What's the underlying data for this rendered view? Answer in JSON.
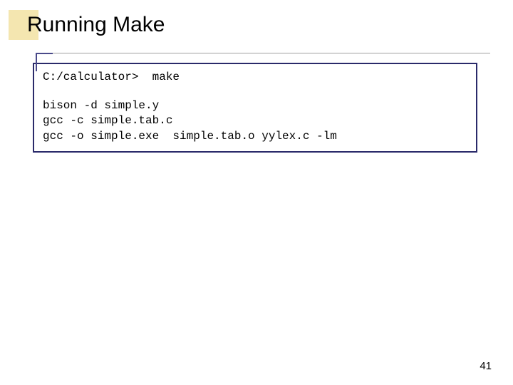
{
  "slide": {
    "title": "Running Make",
    "page_number": "41"
  },
  "terminal": {
    "prompt_line": "C:/calculator>  make",
    "output": {
      "line1": "bison -d simple.y",
      "line2": "gcc -c simple.tab.c",
      "line3": "gcc -o simple.exe  simple.tab.o yylex.c -lm"
    }
  }
}
